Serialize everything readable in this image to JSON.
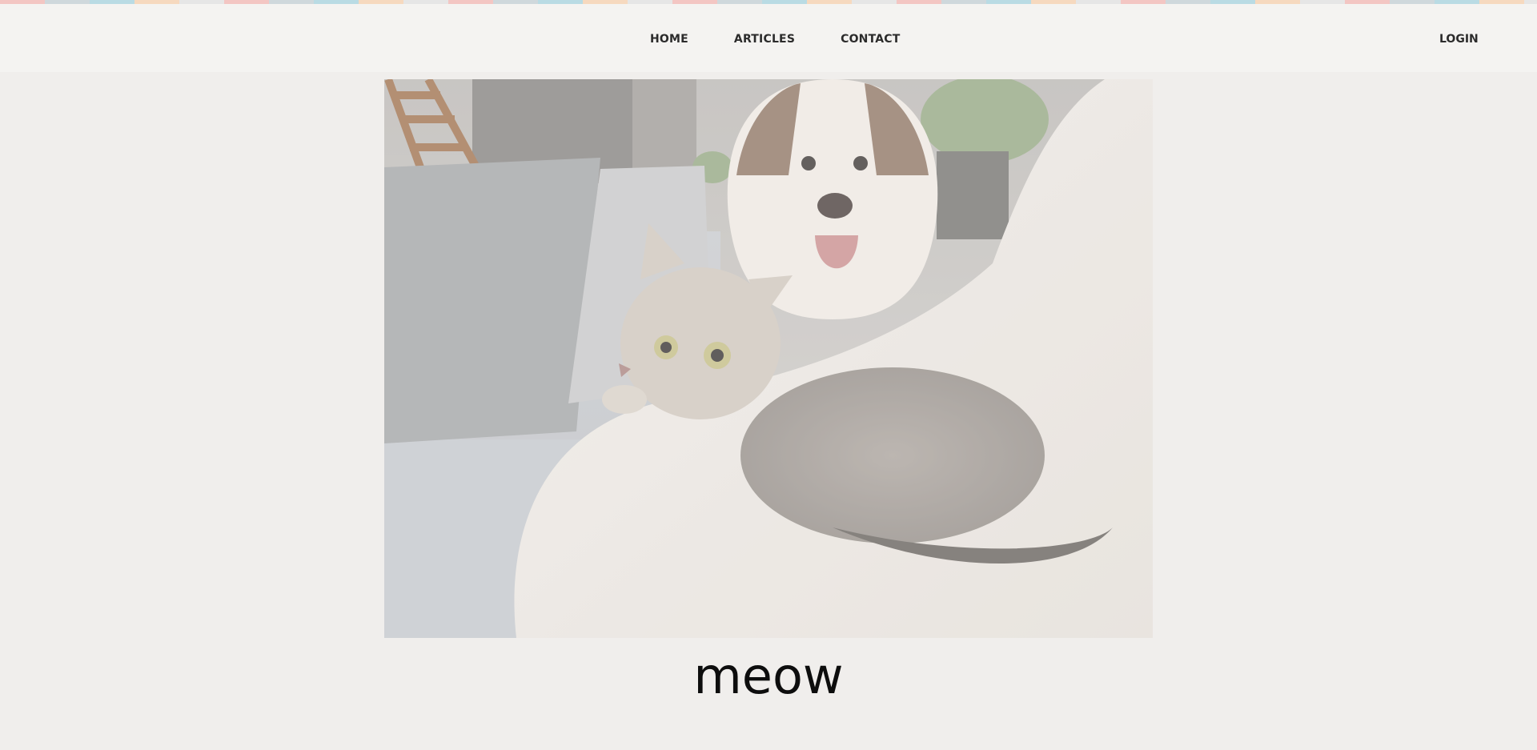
{
  "nav": {
    "links": [
      "HOME",
      "ARTICLES",
      "CONTACT"
    ],
    "login_label": "LOGIN"
  },
  "hero": {
    "image_subject": "cat-and-dog-photo"
  },
  "caption": {
    "text": "meow"
  },
  "colors": {
    "page_background": "#f0eeec",
    "navbar_background": "#f4f3f1",
    "nav_text": "#2b2b2b",
    "caption_text": "#0d0d0d"
  }
}
